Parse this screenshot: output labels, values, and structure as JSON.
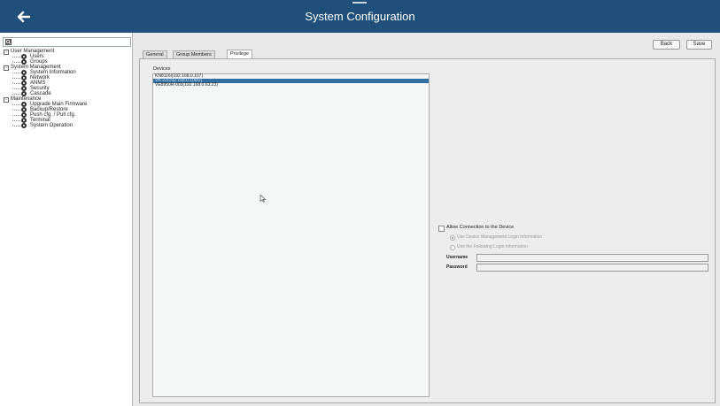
{
  "header": {
    "title": "System Configuration"
  },
  "colors": {
    "topbar": "#1f4f7b",
    "selected_row": "#2f6e9e",
    "icons": [
      "back-arrow-icon",
      "search-icon",
      "tree-node-icon",
      "collapse-toggle-icon",
      "mouse-cursor-icon"
    ]
  },
  "search": {
    "value": ""
  },
  "tree": {
    "sections": [
      {
        "label": "User Management",
        "items": [
          {
            "label": "Users"
          },
          {
            "label": "Groups"
          }
        ]
      },
      {
        "label": "System Management",
        "items": [
          {
            "label": "System Information"
          },
          {
            "label": "Network"
          },
          {
            "label": "ANMS"
          },
          {
            "label": "Security"
          },
          {
            "label": "Cascade"
          }
        ]
      },
      {
        "label": "Maintenance",
        "items": [
          {
            "label": "Upgrade Main Firmware"
          },
          {
            "label": "Backup/Restore"
          },
          {
            "label": "Push cfg. / Pull cfg."
          },
          {
            "label": "Terminal"
          },
          {
            "label": "System Operation"
          }
        ]
      }
    ]
  },
  "toolbar": {
    "back_label": "Back",
    "save_label": "Save"
  },
  "tabs": [
    {
      "label": "General"
    },
    {
      "label": "Group Members"
    },
    {
      "label": "Privilege"
    }
  ],
  "devices": {
    "label": "Devices",
    "items": [
      {
        "label": "KN8116i(192.168.0.107)"
      },
      {
        "label": "VK-22(192.168.0.100/2)"
      },
      {
        "label": "VE8950R-003(192.168.0.63.23)"
      }
    ]
  },
  "permissions": {
    "allow_label": "Allow Connection to the Device",
    "option_device_login": "Use Device Management Login Information",
    "option_following_login": "Use the Following Login Information",
    "username_label": "Username",
    "password_label": "Password",
    "username_value": "",
    "password_value": ""
  }
}
